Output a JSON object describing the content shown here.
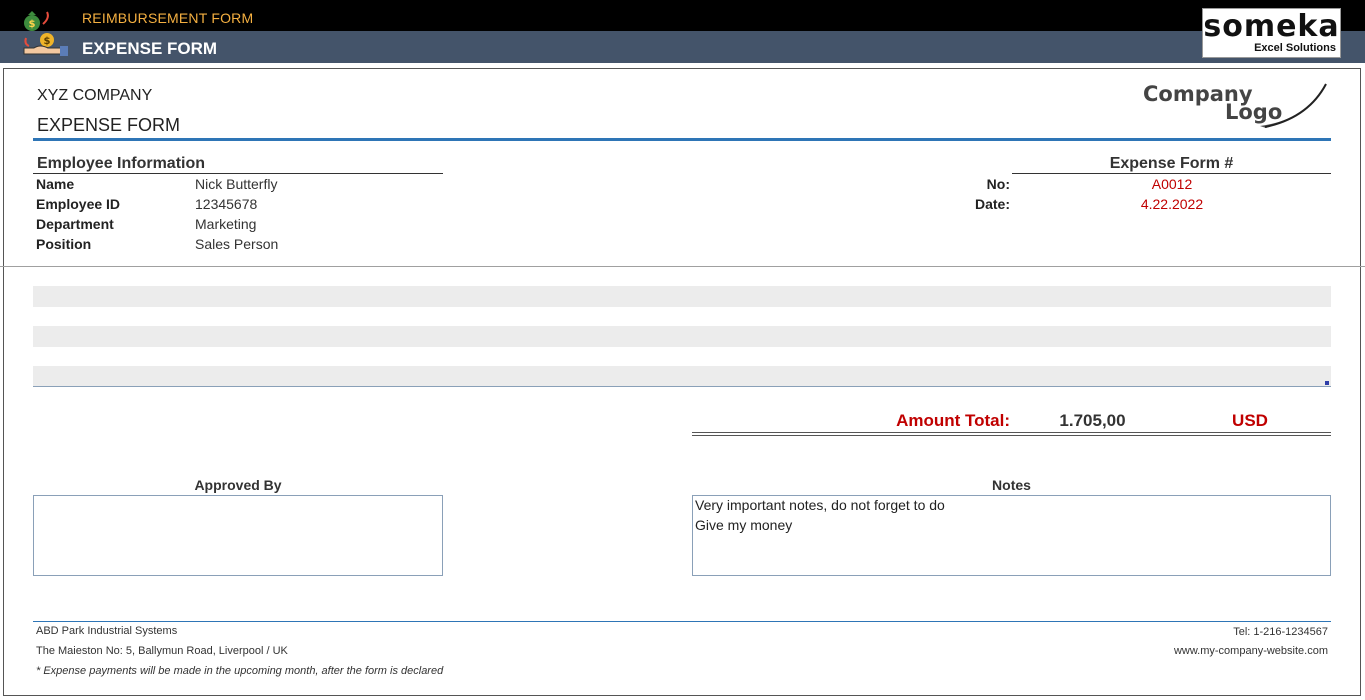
{
  "header": {
    "subtitle": "REIMBURSEMENT FORM",
    "title": "EXPENSE FORM",
    "app_icon": "money-bag-hand-icon",
    "brand": {
      "name": "someka",
      "tagline": "Excel Solutions"
    }
  },
  "company": {
    "name": "XYZ COMPANY",
    "form_heading": "EXPENSE FORM",
    "logo_line1": "Company",
    "logo_line2": "Logo"
  },
  "employee": {
    "section_title": "Employee Information",
    "fields": [
      {
        "label": "Name",
        "value": "Nick Butterfly"
      },
      {
        "label": "Employee ID",
        "value": "12345678"
      },
      {
        "label": "Department",
        "value": "Marketing"
      },
      {
        "label": "Position",
        "value": "Sales Person"
      }
    ]
  },
  "form_meta": {
    "section_title": "Expense Form #",
    "no_label": "No:",
    "no_value": "A0012",
    "date_label": "Date:",
    "date_value": "4.22.2022"
  },
  "totals": {
    "label": "Amount Total:",
    "value": "1.705,00",
    "currency": "USD"
  },
  "approval": {
    "title": "Approved By",
    "value": ""
  },
  "notes": {
    "title": "Notes",
    "lines": [
      "Very important notes, do not forget to do",
      "Give my money"
    ]
  },
  "footer": {
    "company_name": "ABD Park Industrial Systems",
    "address": "The Maieston No: 5, Ballymun Road, Liverpool / UK",
    "note": "* Expense payments will be made in the upcoming month, after the form is declared",
    "phone": "Tel: 1-216-1234567",
    "website": "www.my-company-website.com"
  },
  "colors": {
    "header_black": "#000000",
    "header_slate": "#44546a",
    "accent_blue": "#2e75b6",
    "accent_red": "#c00000",
    "subtitle_orange": "#f5b041"
  }
}
